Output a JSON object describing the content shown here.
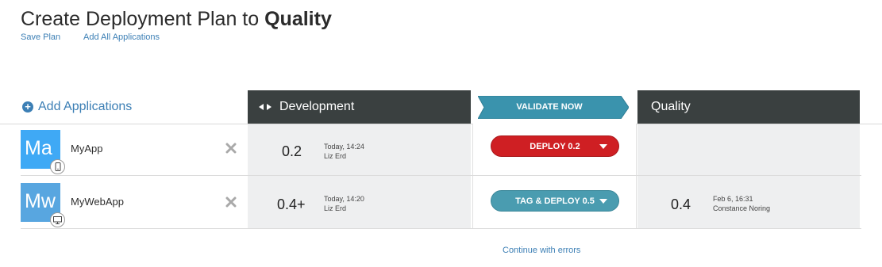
{
  "header": {
    "title_prefix": "Create Deployment Plan to ",
    "title_target": "Quality",
    "save_plan": "Save Plan",
    "add_all": "Add All Applications"
  },
  "add_applications": "Add Applications",
  "environments": {
    "source": "Development",
    "target": "Quality",
    "validate": "VALIDATE NOW"
  },
  "apps": [
    {
      "initials": "Ma",
      "name": "MyApp",
      "device": "mobile-icon",
      "dev_version": "0.2",
      "dev_time": "Today, 14:24",
      "dev_user": "Liz Erd",
      "action": "DEPLOY 0.2",
      "action_color": "#cf1f23",
      "qa_version": "",
      "qa_time": "",
      "qa_user": ""
    },
    {
      "initials": "Mw",
      "name": "MyWebApp",
      "device": "desktop-icon",
      "dev_version": "0.4+",
      "dev_time": "Today, 14:20",
      "dev_user": "Liz Erd",
      "action": "TAG & DEPLOY 0.5",
      "action_color": "#4a9cb0",
      "qa_version": "0.4",
      "qa_time": "Feb 6, 16:31",
      "qa_user": "Constance Noring"
    }
  ],
  "continue_link": "Continue with errors",
  "colors": {
    "link": "#3c7fb5",
    "env_header": "#3a4040",
    "validate": "#3a93ad"
  }
}
